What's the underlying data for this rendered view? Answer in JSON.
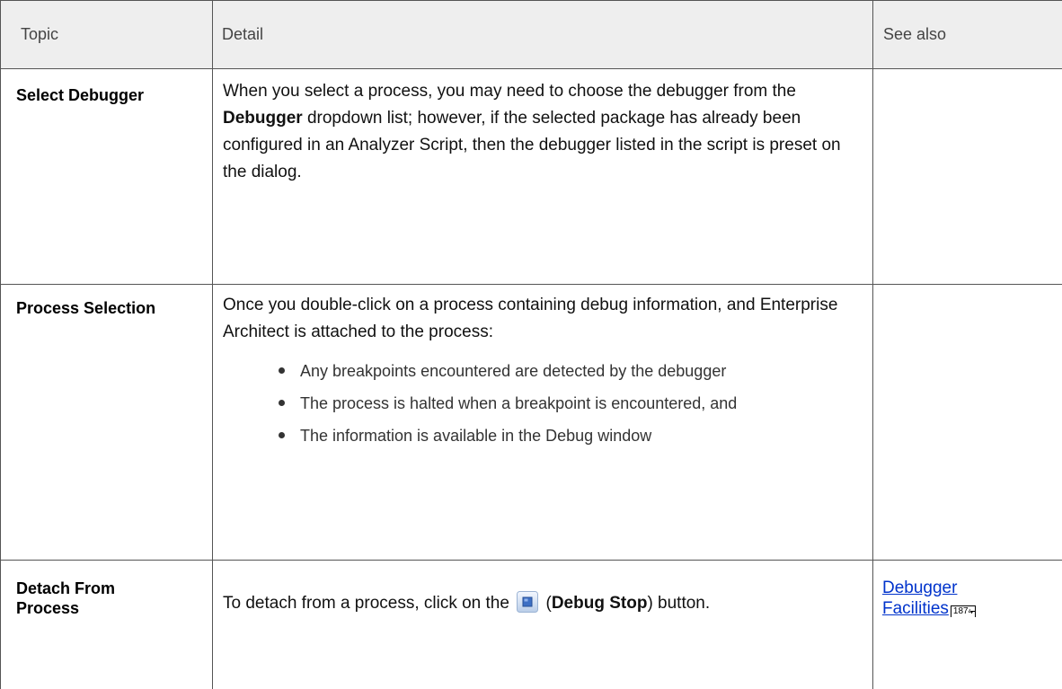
{
  "header": {
    "col1": "Topic",
    "col2": "Detail",
    "col3": "See also"
  },
  "rows": [
    {
      "topic": "Select Debugger",
      "detail_pre": "When you select a process, you may need to choose the debugger from the ",
      "detail_bold": "Debugger",
      "detail_post": " dropdown list; however, if the selected package has already been configured in an Analyzer Script, then the debugger listed in the script is preset on the dialog.",
      "see_also": ""
    },
    {
      "topic": "Process Selection",
      "detail_intro": "Once you double-click on a process containing debug information, and Enterprise Architect is attached to the process:",
      "bullets": [
        "Any breakpoints encountered are detected by the debugger",
        "The process is halted when a breakpoint is encountered, and",
        "The information is available in the Debug window"
      ],
      "see_also": ""
    },
    {
      "topic_line1": "Detach From",
      "topic_line2": "Process",
      "detail_pre": "To detach from a process, click on the",
      "detail_paren_open": "(",
      "detail_bold": "Debug Stop",
      "detail_post": ") button.",
      "icon": "debug-stop-icon",
      "see_also_line1": "Debugger",
      "see_also_line2": "Facilities",
      "see_also_page": "1874"
    }
  ],
  "colors": {
    "header_bg": "#eeeeee",
    "link": "#0033cc",
    "grid": "#555555"
  }
}
